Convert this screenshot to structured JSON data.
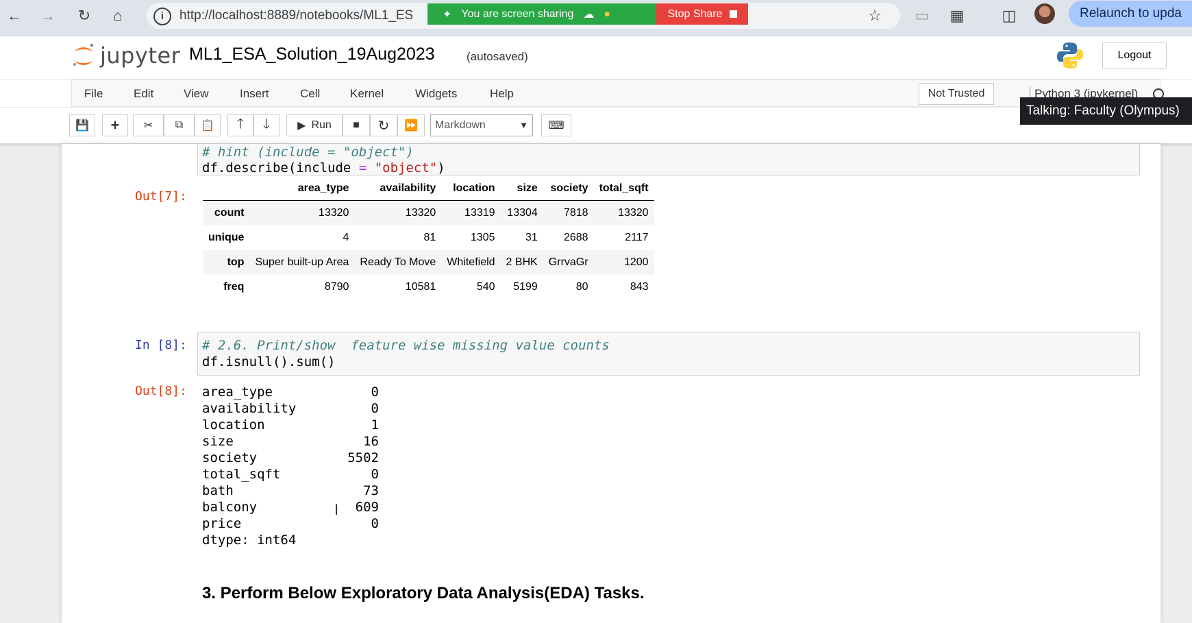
{
  "browser": {
    "url": "http://localhost:8889/notebooks/ML1_ES",
    "share_text": "You are screen sharing",
    "stop_share_label": "Stop Share",
    "relaunch_label": "Relaunch to upda"
  },
  "header": {
    "logo_text": "jupyter",
    "notebook_title": "ML1_ESA_Solution_19Aug2023",
    "autosave_status": "(autosaved)",
    "logout_label": "Logout"
  },
  "menubar": {
    "items": [
      "File",
      "Edit",
      "View",
      "Insert",
      "Cell",
      "Kernel",
      "Widgets",
      "Help"
    ],
    "trust_label": "Not Trusted",
    "kernel_name": "Python 3 (ipykernel)"
  },
  "tooltip": {
    "talking": "Talking: Faculty (Olympus)"
  },
  "toolbar": {
    "run_label": "Run",
    "cell_type": "Markdown"
  },
  "cells": {
    "cell7": {
      "code": [
        "# hint (include = \"object\")",
        "df.describe(include = \"object\")"
      ],
      "out_prompt": "Out[7]:",
      "table": {
        "columns": [
          "",
          "area_type",
          "availability",
          "location",
          "size",
          "society",
          "total_sqft"
        ],
        "rows": [
          [
            "count",
            "13320",
            "13320",
            "13319",
            "13304",
            "7818",
            "13320"
          ],
          [
            "unique",
            "4",
            "81",
            "1305",
            "31",
            "2688",
            "2117"
          ],
          [
            "top",
            "Super built-up Area",
            "Ready To Move",
            "Whitefield",
            "2 BHK",
            "GrrvaGr",
            "1200"
          ],
          [
            "freq",
            "8790",
            "10581",
            "540",
            "5199",
            "80",
            "843"
          ]
        ]
      }
    },
    "cell8": {
      "in_prompt": "In [8]:",
      "code_comment": "# 2.6. Print/show  feature wise missing value counts",
      "code_line2": "df.isnull().sum()",
      "out_prompt": "Out[8]:",
      "series": [
        [
          "area_type",
          "0"
        ],
        [
          "availability",
          "0"
        ],
        [
          "location",
          "1"
        ],
        [
          "size",
          "16"
        ],
        [
          "society",
          "5502"
        ],
        [
          "total_sqft",
          "0"
        ],
        [
          "bath",
          "73"
        ],
        [
          "balcony",
          "609"
        ],
        [
          "price",
          "0"
        ]
      ],
      "dtype": "dtype: int64"
    },
    "markdown": {
      "heading": "3. Perform Below Exploratory Data Analysis(EDA) Tasks."
    }
  }
}
